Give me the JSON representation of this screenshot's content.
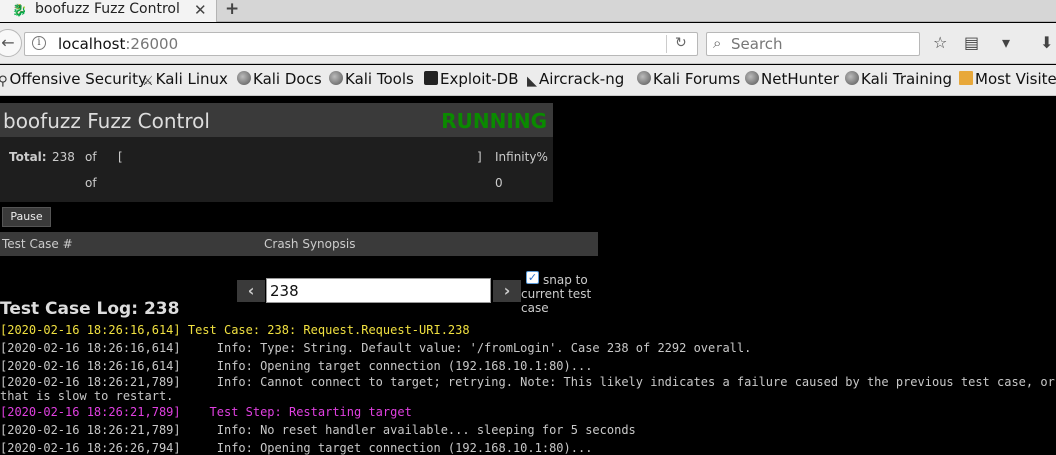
{
  "browser": {
    "tab_title": "boofuzz Fuzz Control",
    "tab_close": "✕",
    "new_tab": "+",
    "url_host": "localhost",
    "url_port": ":26000",
    "search_placeholder": "Search"
  },
  "bookmarks": [
    {
      "label": "Offensive Security",
      "icon": "dragon-icon"
    },
    {
      "label": "Kali Linux",
      "icon": "dragon-icon"
    },
    {
      "label": "Kali Docs",
      "icon": "globe-icon"
    },
    {
      "label": "Kali Tools",
      "icon": "globe-icon"
    },
    {
      "label": "Exploit-DB",
      "icon": "exploitdb-icon"
    },
    {
      "label": "Aircrack-ng",
      "icon": "aircrack-icon"
    },
    {
      "label": "Kali Forums",
      "icon": "globe-icon"
    },
    {
      "label": "NetHunter",
      "icon": "globe-icon"
    },
    {
      "label": "Kali Training",
      "icon": "globe-icon"
    },
    {
      "label": "Most Visited",
      "icon": "folder-icon"
    }
  ],
  "app": {
    "title": "boofuzz Fuzz Control",
    "status": "RUNNING",
    "status_color": "#0a8a00",
    "total_label": "Total:",
    "total_value": "238",
    "of_label": "of",
    "progress_open": "[",
    "progress_close": "]",
    "progress_percent": "Infinity%",
    "of_label_2": "of",
    "second_value": "0",
    "pause_label": "Pause",
    "col_test_case": "Test Case #",
    "col_crash": "Crash Synopsis",
    "case_input_value": "238",
    "snap_label": "snap to current test case",
    "snap_checked": true,
    "log_title": "Test Case Log: 238"
  },
  "log_lines": [
    {
      "text": "[2020-02-16 18:26:16,614] Test Case: 238: Request.Request-URI.238",
      "color": "yellow"
    },
    {
      "text": "[2020-02-16 18:26:16,614]     Info: Type: String. Default value: '/fromLogin'. Case 238 of 2292 overall.",
      "color": "gray"
    },
    {
      "text": "[2020-02-16 18:26:16,614]     Info: Opening target connection (192.168.10.1:80)...",
      "color": "gray"
    },
    {
      "text": "[2020-02-16 18:26:21,789]     Info: Cannot connect to target; retrying. Note: This likely indicates a failure caused by the previous test case, or a target",
      "color": "gray"
    },
    {
      "text": "that is slow to restart.",
      "color": "gray"
    },
    {
      "text": "[2020-02-16 18:26:21,789]    Test Step: Restarting target",
      "color": "magenta"
    },
    {
      "text": "[2020-02-16 18:26:21,789]     Info: No reset handler available... sleeping for 5 seconds",
      "color": "gray"
    },
    {
      "text": "[2020-02-16 18:26:26,794]     Info: Opening target connection (192.168.10.1:80)...",
      "color": "gray"
    }
  ]
}
